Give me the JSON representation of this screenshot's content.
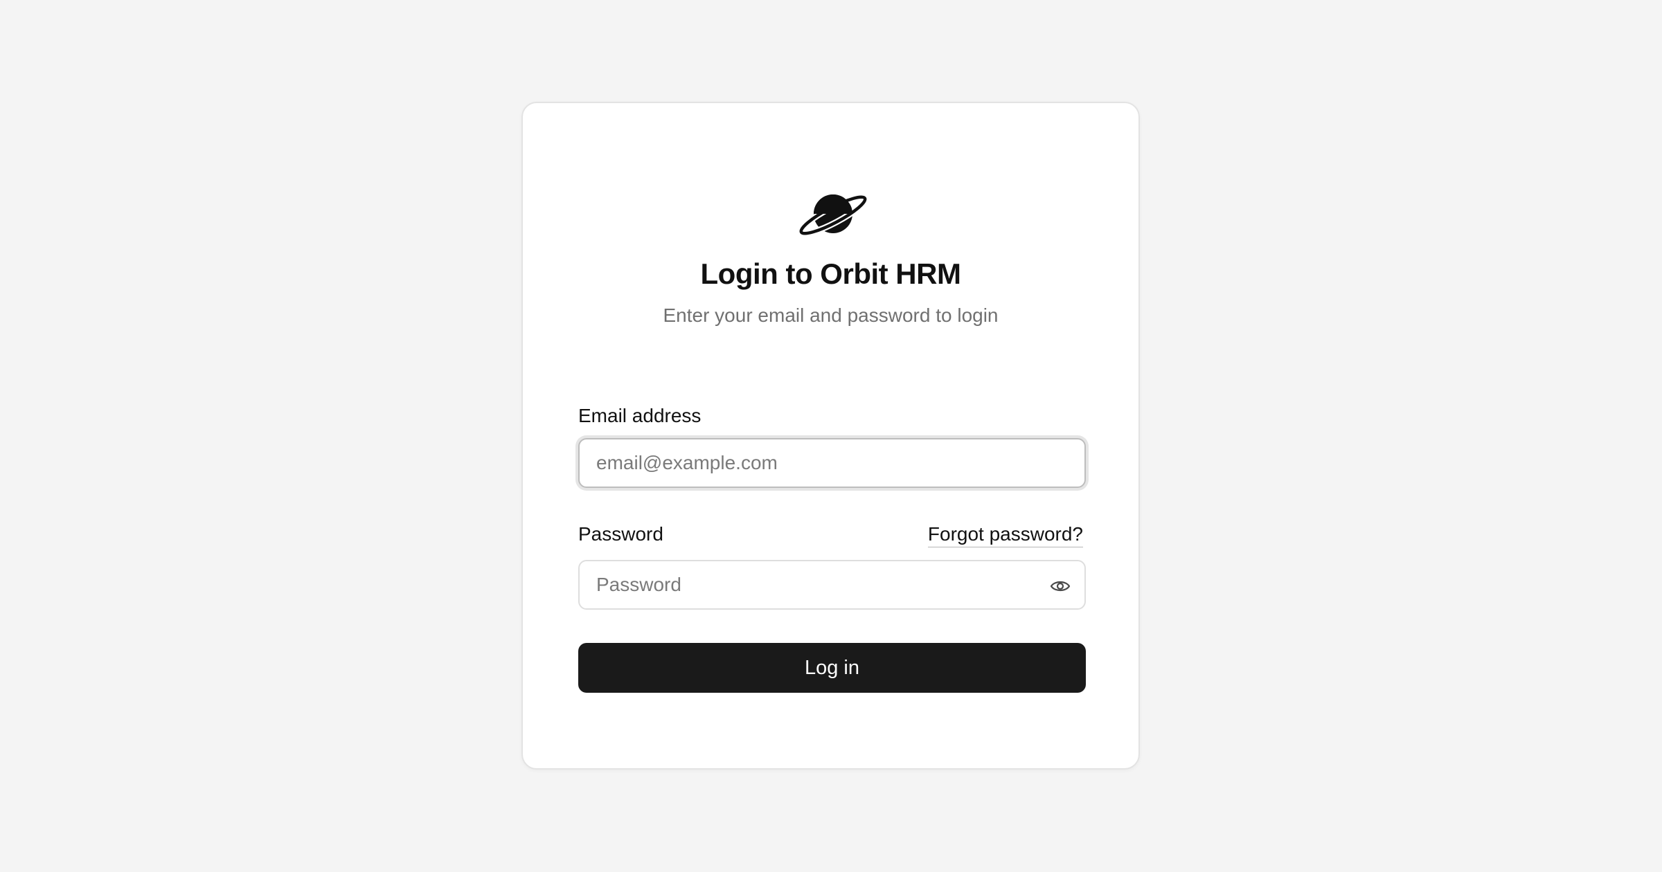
{
  "app": {
    "logo_icon": "planet-icon",
    "title": "Login to Orbit HRM",
    "subtitle": "Enter your email and password to login"
  },
  "form": {
    "email": {
      "label": "Email address",
      "value": "",
      "placeholder": "email@example.com"
    },
    "password": {
      "label": "Password",
      "value": "",
      "placeholder": "Password",
      "toggle_icon": "eye-icon"
    },
    "forgot_link": "Forgot password?",
    "submit_label": "Log in"
  },
  "colors": {
    "background": "#f4f4f4",
    "card": "#ffffff",
    "primary_button": "#1a1a1a",
    "muted_text": "#707070"
  }
}
